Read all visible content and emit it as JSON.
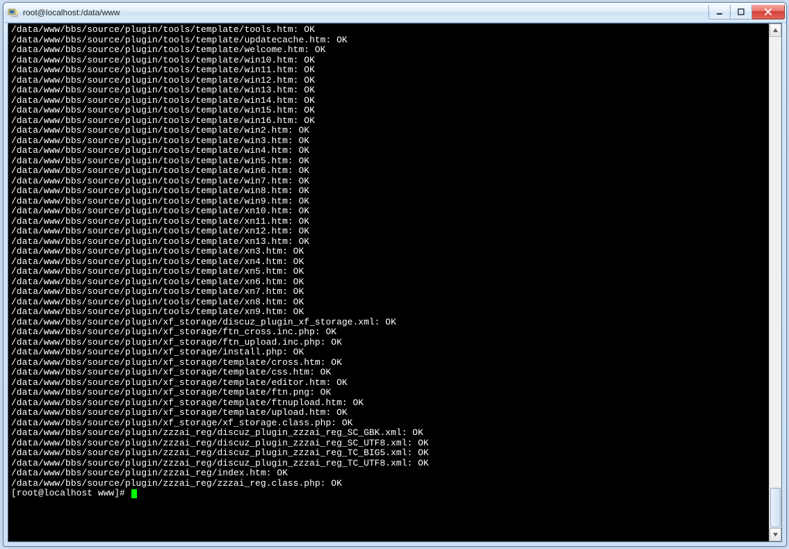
{
  "window": {
    "title": "root@localhost:/data/www"
  },
  "prompt": "[root@localhost www]# ",
  "output_lines": [
    "/data/www/bbs/source/plugin/tools/template/tools.htm: OK",
    "/data/www/bbs/source/plugin/tools/template/updatecache.htm: OK",
    "/data/www/bbs/source/plugin/tools/template/welcome.htm: OK",
    "/data/www/bbs/source/plugin/tools/template/win10.htm: OK",
    "/data/www/bbs/source/plugin/tools/template/win11.htm: OK",
    "/data/www/bbs/source/plugin/tools/template/win12.htm: OK",
    "/data/www/bbs/source/plugin/tools/template/win13.htm: OK",
    "/data/www/bbs/source/plugin/tools/template/win14.htm: OK",
    "/data/www/bbs/source/plugin/tools/template/win15.htm: OK",
    "/data/www/bbs/source/plugin/tools/template/win16.htm: OK",
    "/data/www/bbs/source/plugin/tools/template/win2.htm: OK",
    "/data/www/bbs/source/plugin/tools/template/win3.htm: OK",
    "/data/www/bbs/source/plugin/tools/template/win4.htm: OK",
    "/data/www/bbs/source/plugin/tools/template/win5.htm: OK",
    "/data/www/bbs/source/plugin/tools/template/win6.htm: OK",
    "/data/www/bbs/source/plugin/tools/template/win7.htm: OK",
    "/data/www/bbs/source/plugin/tools/template/win8.htm: OK",
    "/data/www/bbs/source/plugin/tools/template/win9.htm: OK",
    "/data/www/bbs/source/plugin/tools/template/xn10.htm: OK",
    "/data/www/bbs/source/plugin/tools/template/xn11.htm: OK",
    "/data/www/bbs/source/plugin/tools/template/xn12.htm: OK",
    "/data/www/bbs/source/plugin/tools/template/xn13.htm: OK",
    "/data/www/bbs/source/plugin/tools/template/xn3.htm: OK",
    "/data/www/bbs/source/plugin/tools/template/xn4.htm: OK",
    "/data/www/bbs/source/plugin/tools/template/xn5.htm: OK",
    "/data/www/bbs/source/plugin/tools/template/xn6.htm: OK",
    "/data/www/bbs/source/plugin/tools/template/xn7.htm: OK",
    "/data/www/bbs/source/plugin/tools/template/xn8.htm: OK",
    "/data/www/bbs/source/plugin/tools/template/xn9.htm: OK",
    "/data/www/bbs/source/plugin/xf_storage/discuz_plugin_xf_storage.xml: OK",
    "/data/www/bbs/source/plugin/xf_storage/ftn_cross.inc.php: OK",
    "/data/www/bbs/source/plugin/xf_storage/ftn_upload.inc.php: OK",
    "/data/www/bbs/source/plugin/xf_storage/install.php: OK",
    "/data/www/bbs/source/plugin/xf_storage/template/cross.htm: OK",
    "/data/www/bbs/source/plugin/xf_storage/template/css.htm: OK",
    "/data/www/bbs/source/plugin/xf_storage/template/editor.htm: OK",
    "/data/www/bbs/source/plugin/xf_storage/template/ftn.png: OK",
    "/data/www/bbs/source/plugin/xf_storage/template/ftnupload.htm: OK",
    "/data/www/bbs/source/plugin/xf_storage/template/upload.htm: OK",
    "/data/www/bbs/source/plugin/xf_storage/xf_storage.class.php: OK",
    "/data/www/bbs/source/plugin/zzzai_reg/discuz_plugin_zzzai_reg_SC_GBK.xml: OK",
    "/data/www/bbs/source/plugin/zzzai_reg/discuz_plugin_zzzai_reg_SC_UTF8.xml: OK",
    "/data/www/bbs/source/plugin/zzzai_reg/discuz_plugin_zzzai_reg_TC_BIG5.xml: OK",
    "/data/www/bbs/source/plugin/zzzai_reg/discuz_plugin_zzzai_reg_TC_UTF8.xml: OK",
    "/data/www/bbs/source/plugin/zzzai_reg/index.htm: OK",
    "/data/www/bbs/source/plugin/zzzai_reg/zzzai_reg.class.php: OK"
  ]
}
